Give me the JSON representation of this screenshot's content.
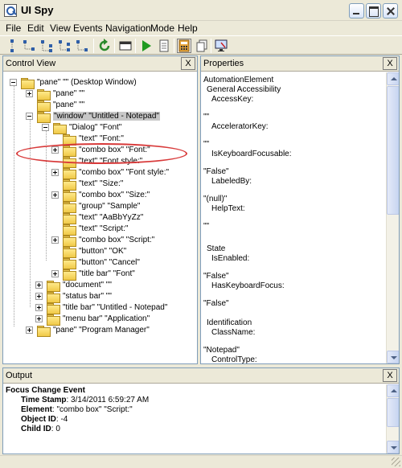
{
  "window": {
    "title": "UI Spy"
  },
  "menu": [
    "File",
    "Edit",
    "View",
    "Events",
    "Navigation",
    "Mode",
    "Help"
  ],
  "toolbar": {
    "icons": [
      "tree-parent-icon",
      "tree-first-child-icon",
      "tree-prev-sibling-icon",
      "tree-next-sibling-icon",
      "tree-last-child-icon",
      "refresh-icon",
      "window-icon",
      "play-icon",
      "document-icon",
      "calculator-icon",
      "copy-icon",
      "screen-icon"
    ]
  },
  "control_view": {
    "title": "Control View",
    "close_label": "X",
    "tree": [
      {
        "label": "\"pane\" \"\" (Desktop Window)"
      },
      {
        "label": "\"pane\" \"\""
      },
      {
        "label": "\"pane\" \"\""
      },
      {
        "label": "\"window\" \"Untitled - Notepad\""
      },
      {
        "label": "\"Dialog\" \"Font\""
      },
      {
        "label": "\"text\" \"Font:\""
      },
      {
        "label": "\"combo box\" \"Font:\""
      },
      {
        "label": "\"text\" \"Font style:\""
      },
      {
        "label": "\"combo box\" \"Font style:\""
      },
      {
        "label": "\"text\" \"Size:\""
      },
      {
        "label": "\"combo box\" \"Size:\""
      },
      {
        "label": "\"group\" \"Sample\""
      },
      {
        "label": "\"text\" \"AaBbYyZz\""
      },
      {
        "label": "\"text\" \"Script:\""
      },
      {
        "label": "\"combo box\" \"Script:\""
      },
      {
        "label": "\"button\" \"OK\""
      },
      {
        "label": "\"button\" \"Cancel\""
      },
      {
        "label": "\"title bar\" \"Font\""
      },
      {
        "label": "\"document\" \"\""
      },
      {
        "label": "\"status bar\" \"\""
      },
      {
        "label": "\"title bar\" \"Untitled - Notepad\""
      },
      {
        "label": "\"menu bar\" \"Application\""
      },
      {
        "label": "\"pane\" \"Program Manager\""
      }
    ]
  },
  "properties": {
    "title": "Properties",
    "close_label": "X",
    "lines": [
      "AutomationElement",
      "General Accessibility",
      "AccessKey:",
      "\"\"",
      "AcceleratorKey:",
      "\"\"",
      "IsKeyboardFocusable:",
      "\"False\"",
      "LabeledBy:",
      "\"(null)\"",
      "HelpText:",
      "\"\"",
      "State",
      "IsEnabled:",
      "\"False\"",
      "HasKeyboardFocus:",
      "\"False\"",
      "Identification",
      "ClassName:",
      "\"Notepad\"",
      "ControlType:"
    ]
  },
  "output": {
    "title": "Output",
    "close_label": "X",
    "event_title": "Focus Change Event",
    "fields": [
      {
        "label": "Time Stamp",
        "value": ": 3/14/2011 6:59:27 AM"
      },
      {
        "label": "Element",
        "value": ": \"combo box\" \"Script:\""
      },
      {
        "label": "Object ID",
        "value": ": -4"
      },
      {
        "label": "Child ID",
        "value": ": 0"
      }
    ]
  },
  "colors": {
    "highlight_ellipse": "#d83a3a",
    "chrome": "#ece9d8",
    "pane_border": "#7f9db9"
  }
}
